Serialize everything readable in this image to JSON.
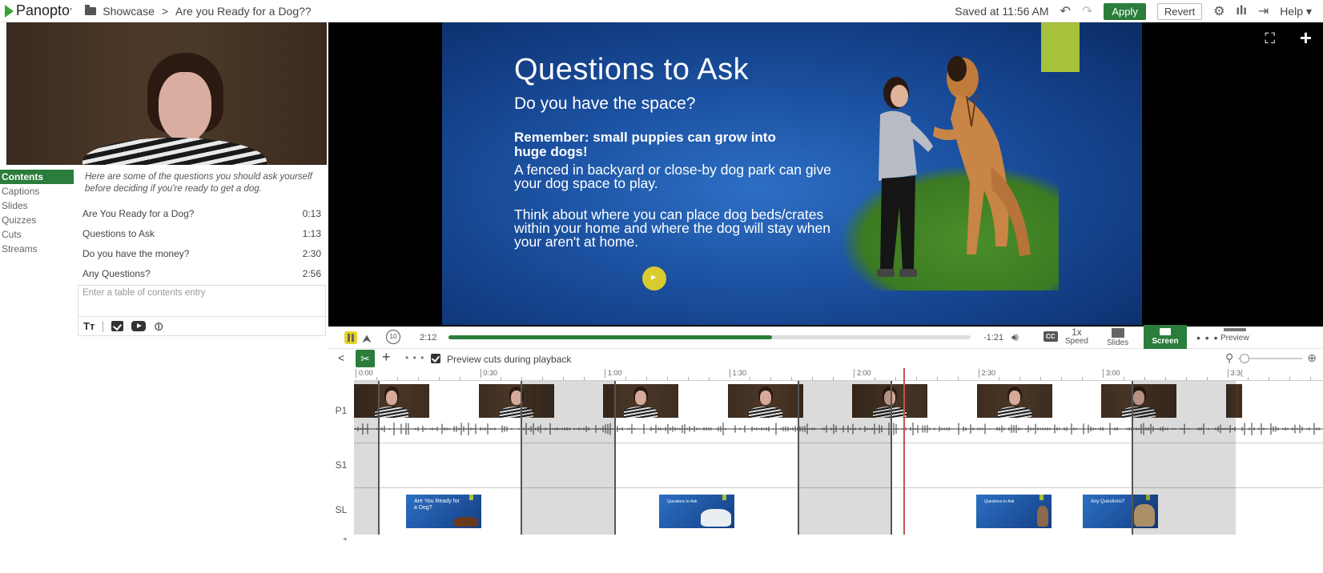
{
  "topbar": {
    "logo": "Panopto",
    "breadcrumb_folder": "Showcase",
    "breadcrumb_sep": ">",
    "breadcrumb_title": "Are you Ready for a Dog??",
    "saved_status": "Saved at 11:56 AM",
    "apply_label": "Apply",
    "revert_label": "Revert",
    "help_label": "Help ▾",
    "undo_icon": "undo-icon",
    "redo_icon": "redo-icon",
    "settings_icon": "gear-icon",
    "stats_icon": "bar-chart-icon",
    "exit_icon": "exit-icon"
  },
  "sidebar": {
    "tabs": [
      {
        "label": "Contents",
        "active": true
      },
      {
        "label": "Captions",
        "active": false
      },
      {
        "label": "Slides",
        "active": false
      },
      {
        "label": "Quizzes",
        "active": false
      },
      {
        "label": "Cuts",
        "active": false
      },
      {
        "label": "Streams",
        "active": false
      }
    ],
    "description": "Here are some of the questions you should ask yourself before deciding if you're ready to get a dog.",
    "toc": [
      {
        "title": "Are You Ready for a Dog?",
        "time": "0:13"
      },
      {
        "title": "Questions to Ask",
        "time": "1:13"
      },
      {
        "title": "Do you have the money?",
        "time": "2:30"
      },
      {
        "title": "Any Questions?",
        "time": "2:56"
      }
    ],
    "entry_placeholder": "Enter a table of contents entry",
    "tools": {
      "text_icon": "Tт",
      "link_icon": "⊖"
    }
  },
  "slide": {
    "title": "Questions to Ask",
    "subtitle": "Do you have the space?",
    "bold": "Remember: small puppies can grow into huge dogs!",
    "p1": "A fenced in backyard or close-by dog park can give your dog space to play.",
    "p2": "Think about where you can place dog beds/crates within your home and where the dog will stay when your aren't at home."
  },
  "playback": {
    "current_time": "2:12",
    "remaining": "-1:21",
    "progress": 0.62,
    "rewind_label": "10",
    "cc_label": "CC",
    "speed_value": "1x",
    "speed_label": "Speed",
    "slides_label": "Slides",
    "screen_label": "Screen",
    "more_label": "• • •",
    "preview_label": "Preview"
  },
  "edit_toolbar": {
    "collapse": "<",
    "add": "+",
    "more": "• • •",
    "preview_cuts_label": "Preview cuts during playback",
    "preview_cuts_checked": true
  },
  "timeline": {
    "ticks": [
      "0:00",
      "0:30",
      "1:00",
      "1:30",
      "2:00",
      "2:30",
      "3:00",
      "3:3("
    ],
    "track_labels": [
      "P1",
      "S1",
      "SL"
    ],
    "slide_thumbs": [
      {
        "title": "Are You Ready for a Dog?"
      },
      {
        "title": "Questions to Ask"
      },
      {
        "title": "Questions to Ask"
      },
      {
        "title": "Any Questions?"
      }
    ]
  },
  "colors": {
    "accent_green": "#2a7d3a",
    "slide_blue": "#1a4e9d",
    "slide_accent": "#a6c13a",
    "playhead": "#c0564a"
  }
}
